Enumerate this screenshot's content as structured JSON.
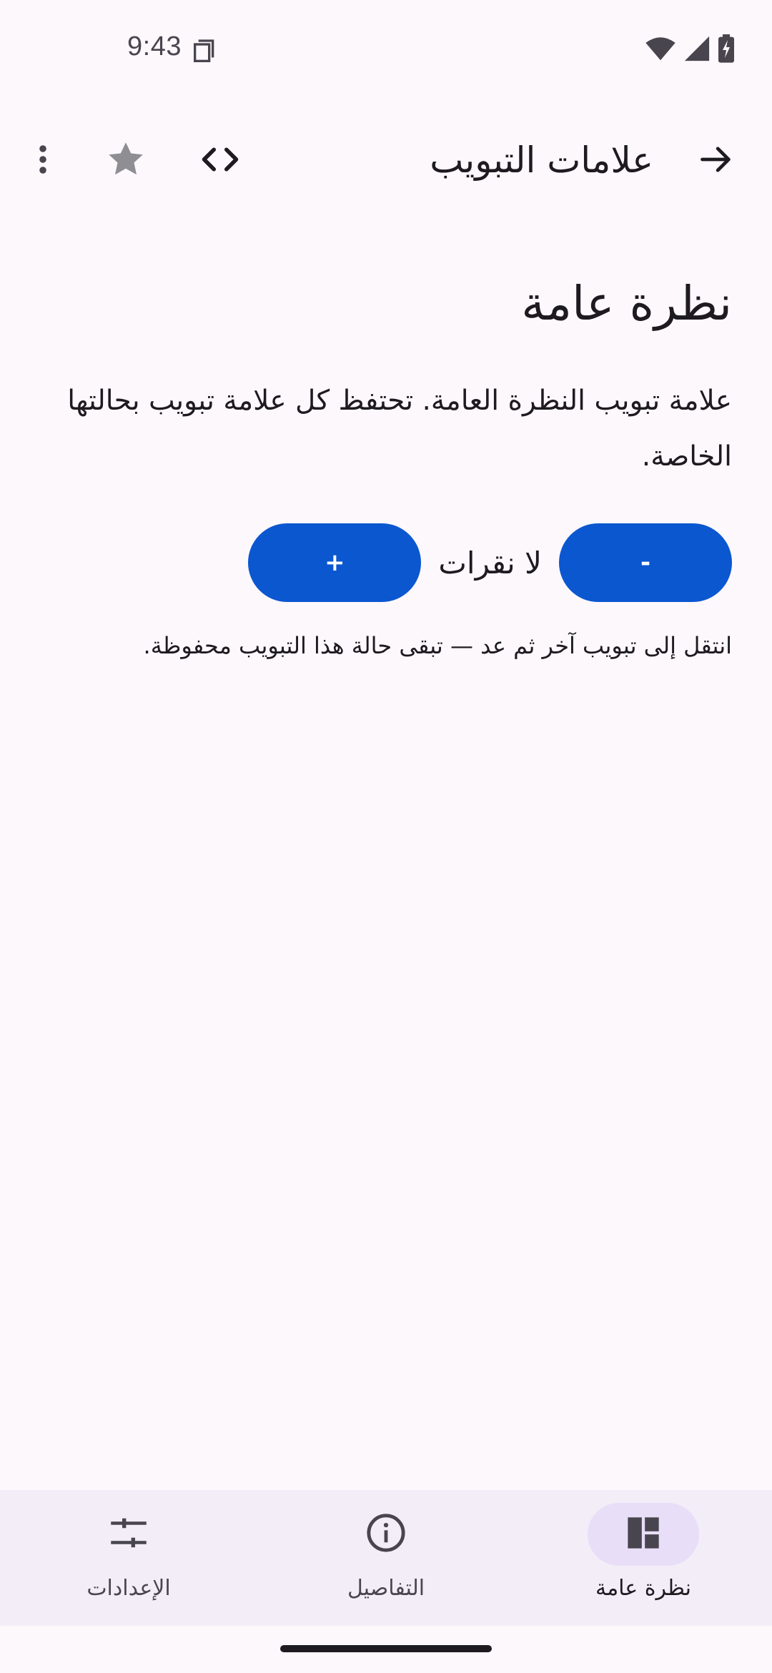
{
  "status_bar": {
    "time": "9:43",
    "icons": [
      "copy-icon",
      "wifi-icon",
      "signal-icon",
      "battery-charging-icon"
    ]
  },
  "top_bar": {
    "title": "علامات التبويب",
    "back_icon": "arrow-forward-icon",
    "actions": [
      "code-icon",
      "star-icon",
      "more-vert-icon"
    ]
  },
  "main": {
    "heading": "نظرة عامة",
    "body": "علامة تبويب النظرة العامة. تحتفظ كل علامة تبويب بحالتها الخاصة.",
    "counter": {
      "decrement_label": "-",
      "label": "لا نقرات",
      "increment_label": "+"
    },
    "hint": "انتقل إلى تبويب آخر ثم عد — تبقى حالة هذا التبويب محفوظة."
  },
  "bottom_nav": {
    "items": [
      {
        "label": "نظرة عامة",
        "icon": "dashboard-icon",
        "active": true
      },
      {
        "label": "التفاصيل",
        "icon": "info-icon",
        "active": false
      },
      {
        "label": "الإعدادات",
        "icon": "tune-icon",
        "active": false
      }
    ]
  },
  "colors": {
    "background": "#FDF8FC",
    "primary_button": "#0B57D0",
    "nav_background": "#F3EDF7",
    "nav_indicator": "#E8DEF8",
    "star": "#8E8E93"
  }
}
